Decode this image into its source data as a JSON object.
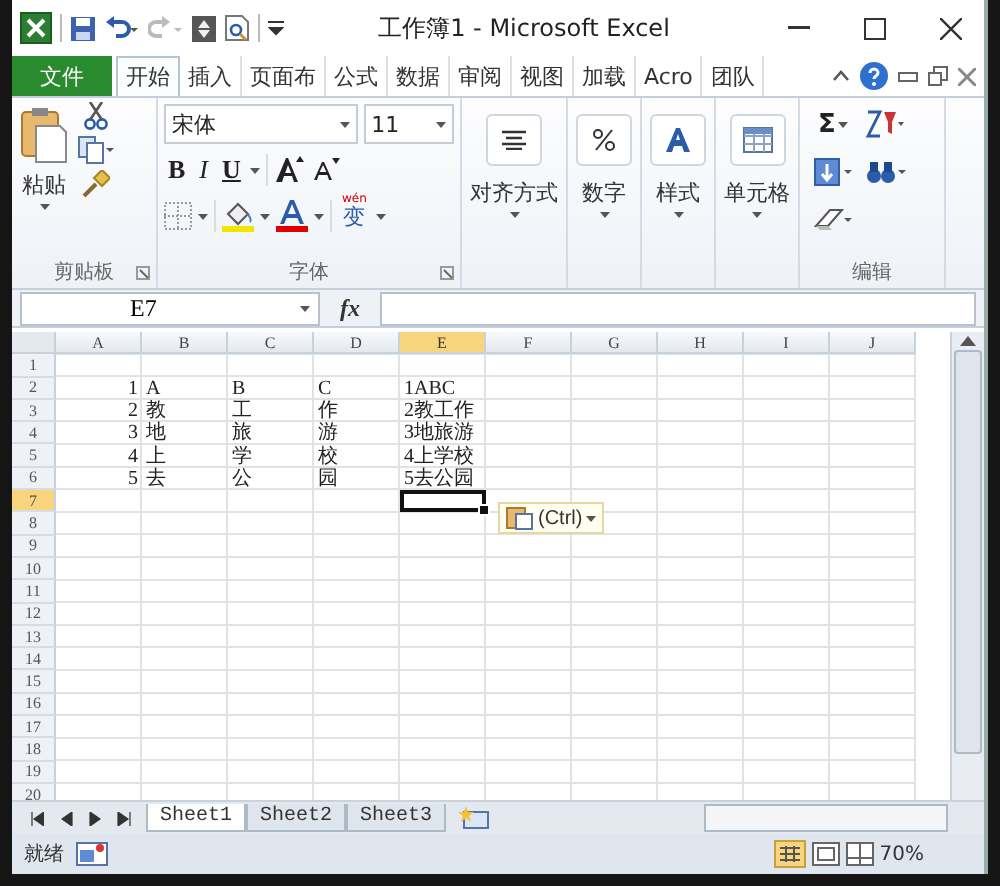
{
  "window": {
    "title": "工作簿1 - Microsoft Excel"
  },
  "ribbon_tabs": [
    {
      "label": "文件",
      "kind": "file",
      "selected": false
    },
    {
      "label": "开始",
      "kind": "tab",
      "selected": true
    },
    {
      "label": "插入",
      "kind": "tab",
      "selected": false
    },
    {
      "label": "页面布",
      "kind": "tab",
      "selected": false
    },
    {
      "label": "公式",
      "kind": "tab",
      "selected": false
    },
    {
      "label": "数据",
      "kind": "tab",
      "selected": false
    },
    {
      "label": "审阅",
      "kind": "tab",
      "selected": false
    },
    {
      "label": "视图",
      "kind": "tab",
      "selected": false
    },
    {
      "label": "加载",
      "kind": "tab",
      "selected": false
    },
    {
      "label": "Acro",
      "kind": "tab",
      "selected": false
    },
    {
      "label": "团队",
      "kind": "tab",
      "selected": false
    }
  ],
  "clipboard": {
    "paste_label": "粘贴",
    "group_label": "剪贴板"
  },
  "font": {
    "name": "宋体",
    "size": "11",
    "bold": "B",
    "italic": "I",
    "underline": "U",
    "phonetic": "wén",
    "phonetic_char": "变",
    "group_label": "字体"
  },
  "big_buttons": [
    {
      "label": "对齐方式",
      "kind": "align"
    },
    {
      "label": "数字",
      "kind": "number"
    },
    {
      "label": "样式",
      "kind": "styles"
    },
    {
      "label": "单元格",
      "kind": "cells"
    }
  ],
  "editing": {
    "sum": "Σ",
    "group_label": "编辑"
  },
  "formula_bar": {
    "name_box": "E7",
    "function_label": "fx"
  },
  "sheet": {
    "columns": [
      {
        "label": "A",
        "selected": false
      },
      {
        "label": "B",
        "selected": false
      },
      {
        "label": "C",
        "selected": false
      },
      {
        "label": "D",
        "selected": false
      },
      {
        "label": "E",
        "selected": true
      },
      {
        "label": "F",
        "selected": false
      },
      {
        "label": "G",
        "selected": false
      },
      {
        "label": "H",
        "selected": false
      },
      {
        "label": "I",
        "selected": false
      },
      {
        "label": "J",
        "selected": false
      }
    ],
    "rows": [
      {
        "number": "1",
        "selected": false
      },
      {
        "number": "2",
        "selected": false,
        "cells": [
          {
            "text": "1",
            "kind": "number"
          },
          {
            "text": "A",
            "kind": "text"
          },
          {
            "text": "B",
            "kind": "text"
          },
          {
            "text": "C",
            "kind": "text"
          },
          {
            "text": "1ABC",
            "kind": "text"
          }
        ]
      },
      {
        "number": "3",
        "selected": false,
        "cells": [
          {
            "text": "2",
            "kind": "number"
          },
          {
            "text": "教",
            "kind": "text"
          },
          {
            "text": "工",
            "kind": "text"
          },
          {
            "text": "作",
            "kind": "text"
          },
          {
            "text": "2教工作",
            "kind": "text"
          }
        ]
      },
      {
        "number": "4",
        "selected": false,
        "cells": [
          {
            "text": "3",
            "kind": "number"
          },
          {
            "text": "地",
            "kind": "text"
          },
          {
            "text": "旅",
            "kind": "text"
          },
          {
            "text": "游",
            "kind": "text"
          },
          {
            "text": "3地旅游",
            "kind": "text"
          }
        ]
      },
      {
        "number": "5",
        "selected": false,
        "cells": [
          {
            "text": "4",
            "kind": "number"
          },
          {
            "text": "上",
            "kind": "text"
          },
          {
            "text": "学",
            "kind": "text"
          },
          {
            "text": "校",
            "kind": "text"
          },
          {
            "text": "4上学校",
            "kind": "text"
          }
        ]
      },
      {
        "number": "6",
        "selected": false,
        "cells": [
          {
            "text": "5",
            "kind": "number"
          },
          {
            "text": "去",
            "kind": "text"
          },
          {
            "text": "公",
            "kind": "text"
          },
          {
            "text": "园",
            "kind": "text"
          },
          {
            "text": "5去公园",
            "kind": "text"
          }
        ]
      },
      {
        "number": "7",
        "selected": true
      },
      {
        "number": "8",
        "selected": false
      },
      {
        "number": "9",
        "selected": false
      },
      {
        "number": "10",
        "selected": false
      },
      {
        "number": "11",
        "selected": false
      },
      {
        "number": "12",
        "selected": false
      },
      {
        "number": "13",
        "selected": false
      },
      {
        "number": "14",
        "selected": false
      },
      {
        "number": "15",
        "selected": false
      },
      {
        "number": "16",
        "selected": false
      },
      {
        "number": "17",
        "selected": false
      },
      {
        "number": "18",
        "selected": false
      },
      {
        "number": "19",
        "selected": false
      },
      {
        "number": "20",
        "selected": false
      }
    ]
  },
  "paste_options": {
    "label": "(Ctrl)"
  },
  "sheet_tabs": [
    {
      "label": "Sheet1",
      "selected": true
    },
    {
      "label": "Sheet2",
      "selected": false
    },
    {
      "label": "Sheet3",
      "selected": false
    }
  ],
  "status_bar": {
    "text": "就绪",
    "zoom": "70%"
  }
}
